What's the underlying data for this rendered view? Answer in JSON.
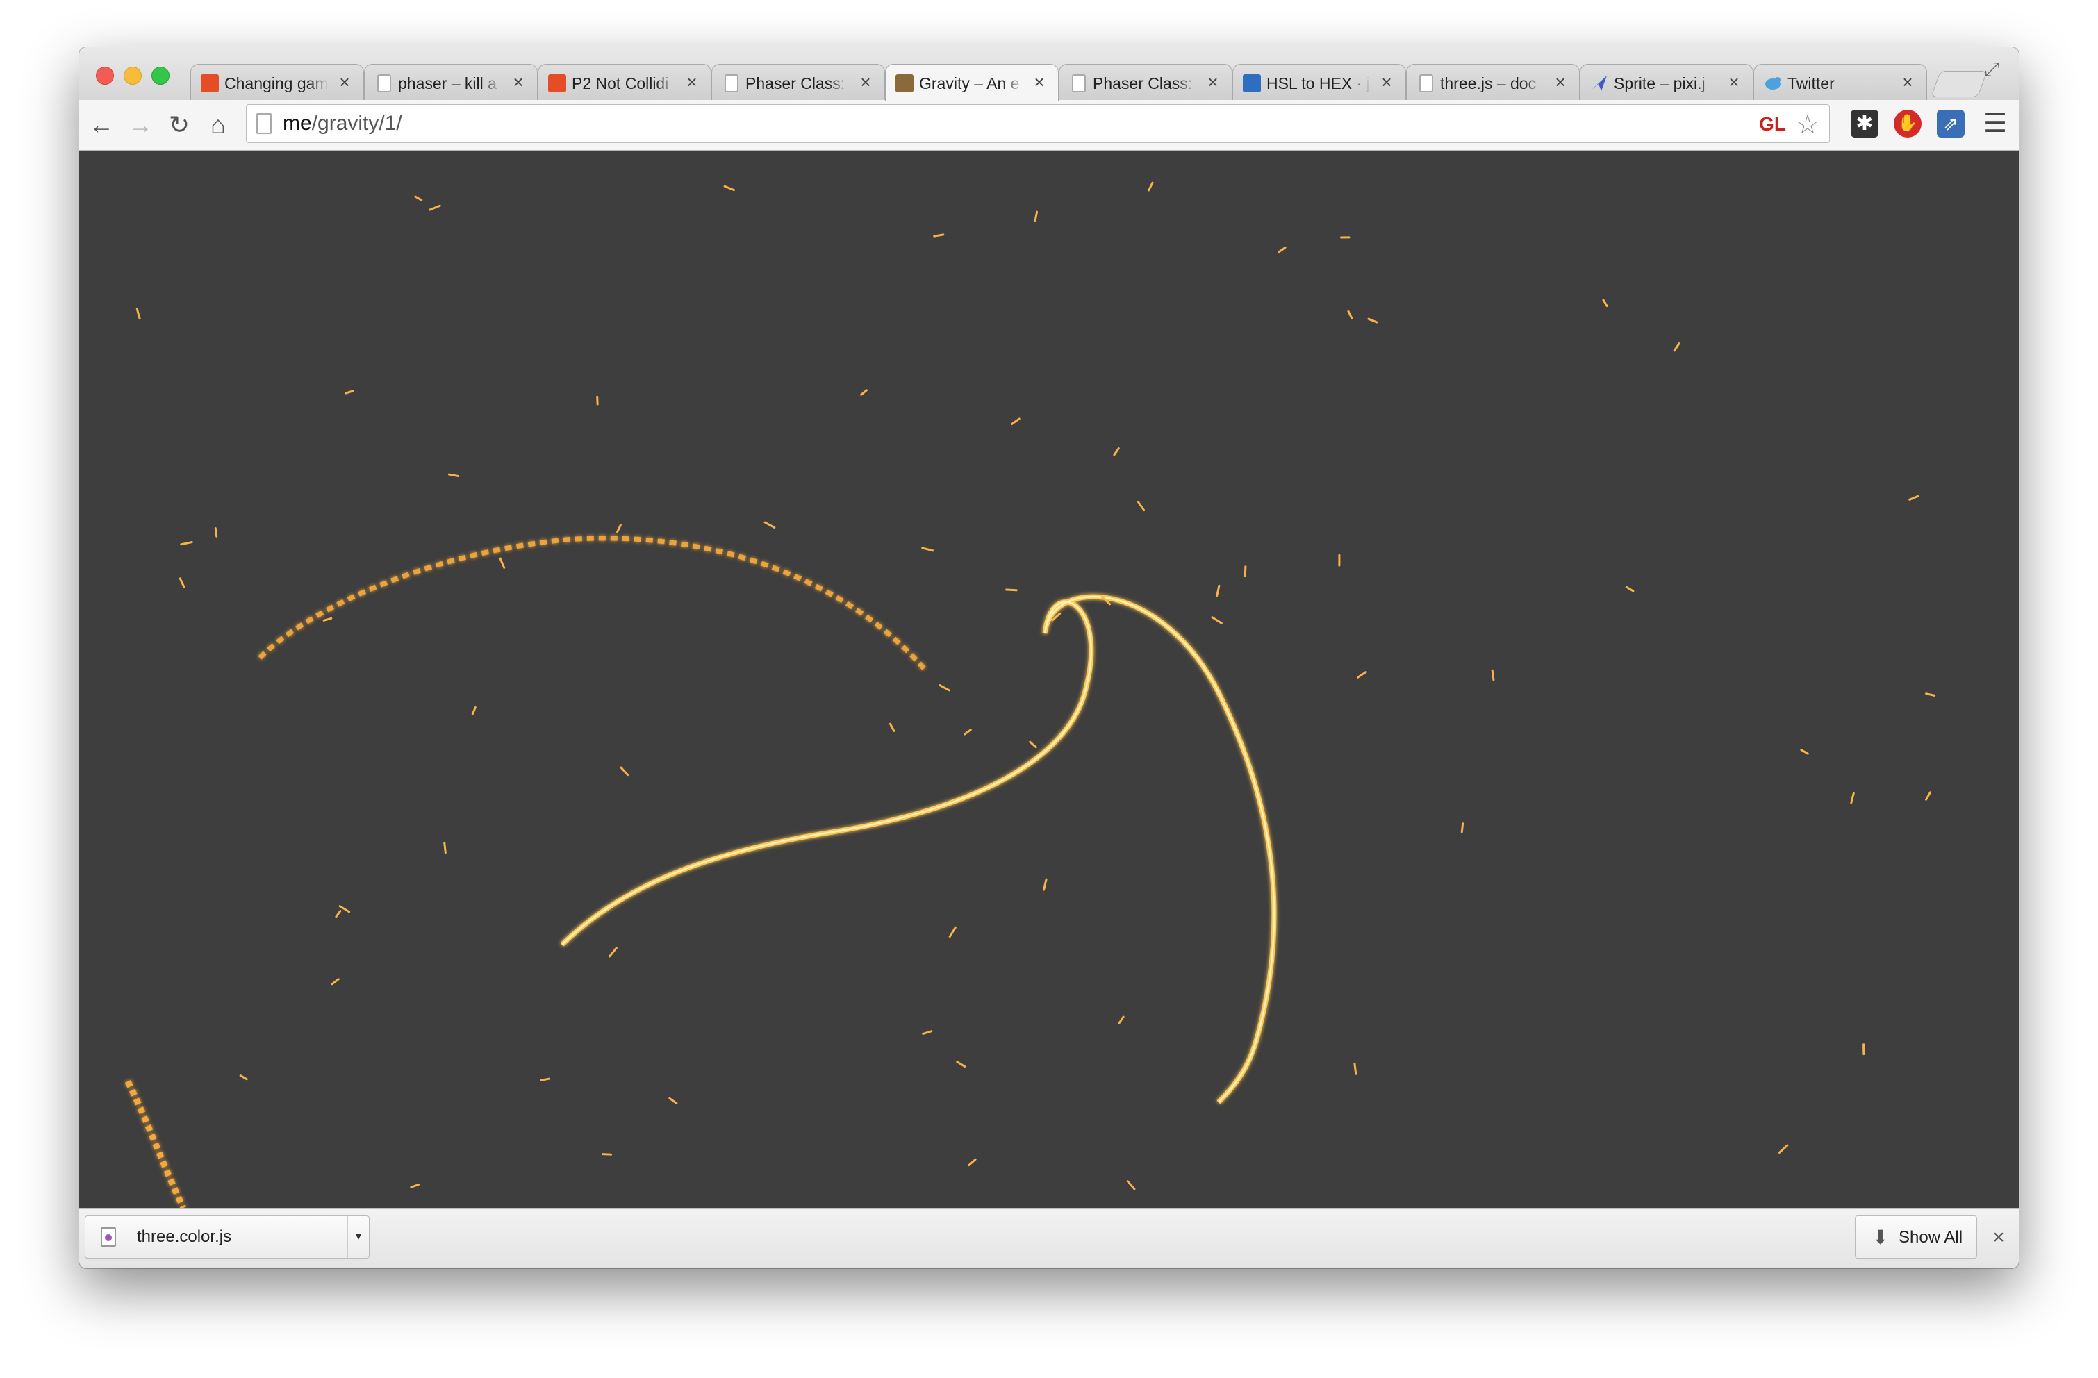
{
  "tabs": [
    {
      "title": "Changing gam",
      "favicon": "html5-icon",
      "active": false
    },
    {
      "title": "phaser – kill a",
      "favicon": "document-icon",
      "active": false
    },
    {
      "title": "P2 Not Collidi",
      "favicon": "html5-icon",
      "active": false
    },
    {
      "title": "Phaser Class: ",
      "favicon": "document-icon",
      "active": false
    },
    {
      "title": "Gravity – An e",
      "favicon": "gravity-icon",
      "active": true
    },
    {
      "title": "Phaser Class: ",
      "favicon": "document-icon",
      "active": false
    },
    {
      "title": "HSL to HEX · j",
      "favicon": "hsl-icon",
      "active": false
    },
    {
      "title": "three.js – doc",
      "favicon": "document-icon",
      "active": false
    },
    {
      "title": "Sprite – pixi.j",
      "favicon": "pixi-icon",
      "active": false
    },
    {
      "title": "Twitter",
      "favicon": "twitter-icon",
      "active": false
    }
  ],
  "toolbar": {
    "url_host": "me",
    "url_path": "/gravity/1/",
    "gl_badge": "GL"
  },
  "downloads": {
    "file_name": "three.color.js",
    "show_all_label": "Show All"
  },
  "colors": {
    "canvas_bg": "#3e3e3e",
    "particle": "#f7b24a",
    "particle_glow": "#ffd97a"
  }
}
